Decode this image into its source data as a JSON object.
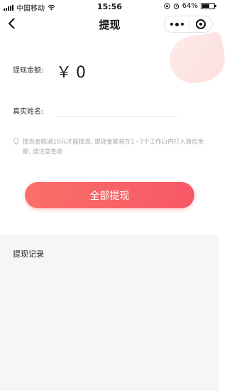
{
  "statusbar": {
    "carrier": "中国移动",
    "time": "15:56",
    "battery": "64%",
    "battery_level": 0.64
  },
  "nav": {
    "title": "提现"
  },
  "form": {
    "amount_label": "提现金额:",
    "currency": "￥",
    "amount_value": "0",
    "name_label": "真实姓名:",
    "name_value": ""
  },
  "tip": {
    "text": "提现金额满10元才能提现, 提现金额将在1~7个工作日内打入微信余额, 请注意查收"
  },
  "actions": {
    "withdraw_all_label": "全部提现"
  },
  "records": {
    "title": "提现记录"
  },
  "colors": {
    "button_start": "#fa6f6a",
    "button_end": "#f75866",
    "records_bg": "#f6f6f6"
  }
}
